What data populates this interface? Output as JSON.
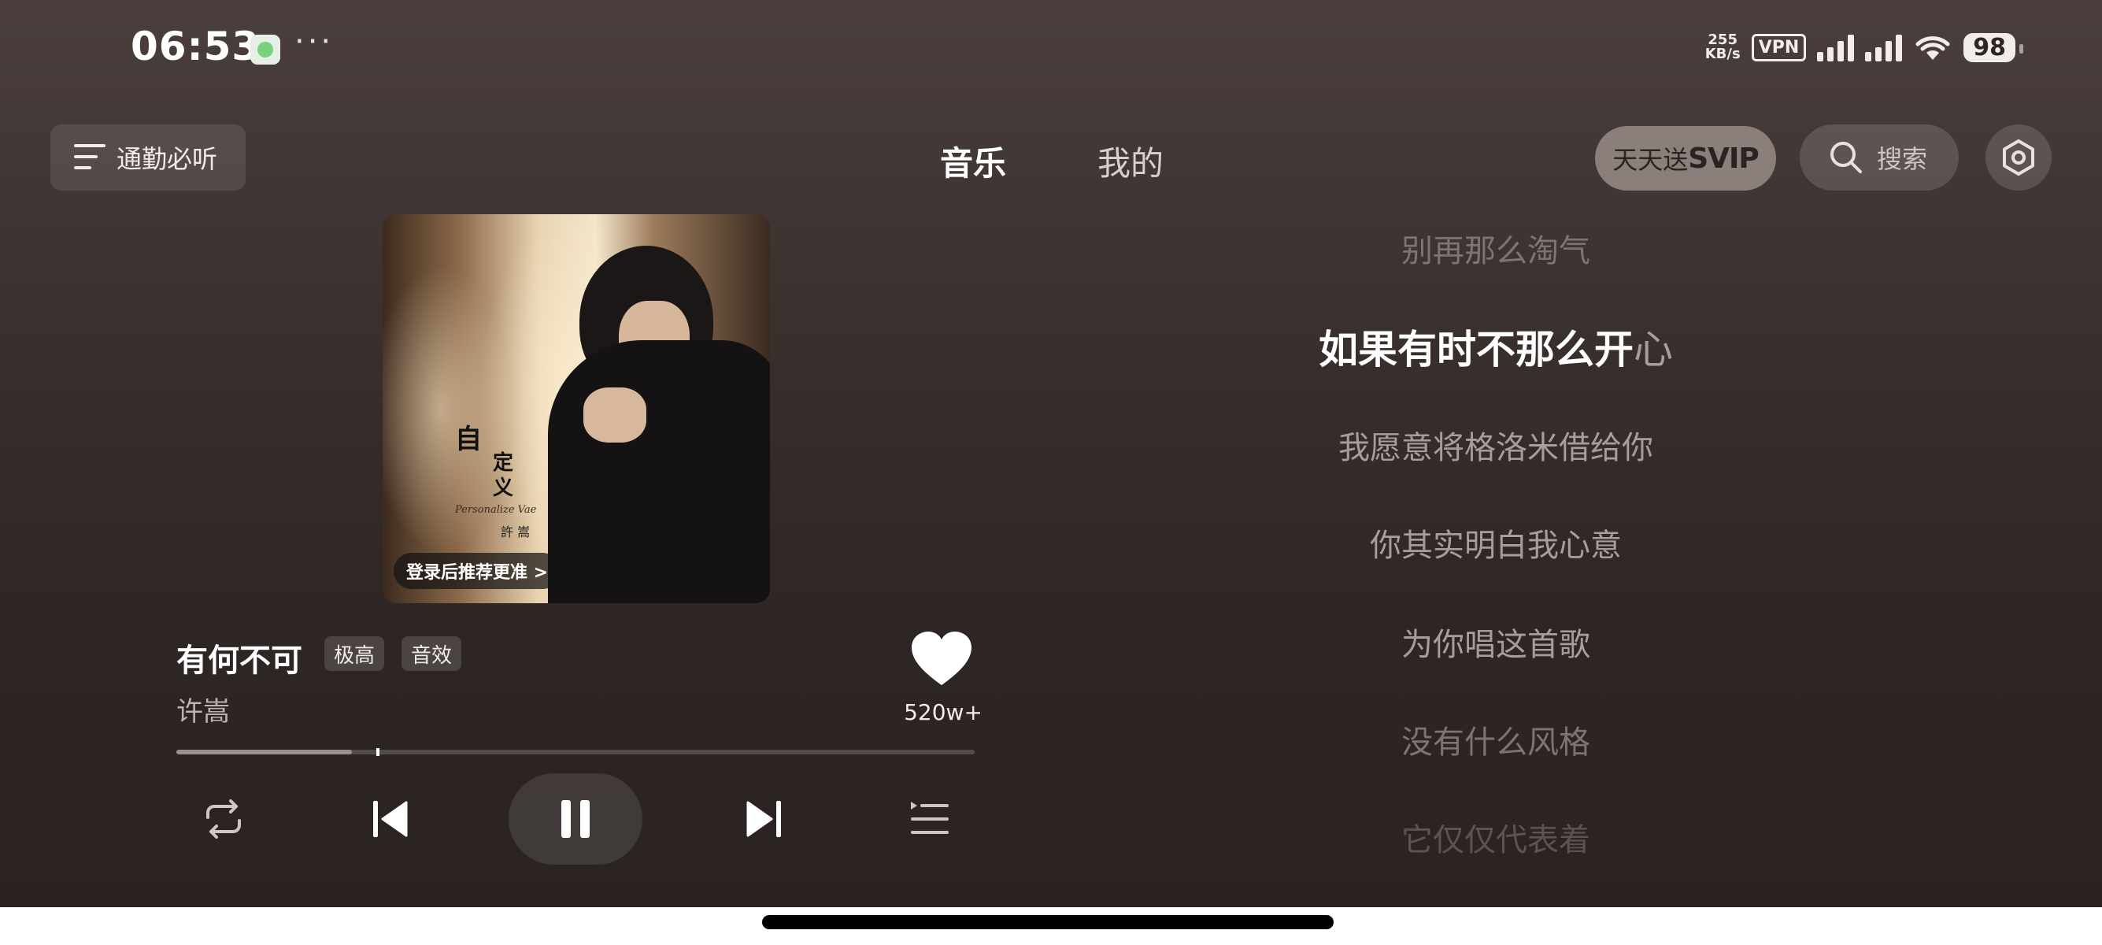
{
  "status_bar": {
    "time": "06:53",
    "more": "···",
    "net_speed_value": "255",
    "net_speed_unit": "KB/s",
    "vpn_label": "VPN",
    "battery": "98"
  },
  "nav": {
    "commute_label": "通勤必听",
    "tabs": [
      {
        "label": "音乐",
        "active": true
      },
      {
        "label": "我的",
        "active": false
      }
    ],
    "svip_prefix": "天天送",
    "svip_suffix": "SVIP",
    "search_label": "搜索"
  },
  "album": {
    "cover_title_1": "自",
    "cover_title_2": "定\n义",
    "cover_subtitle": "Personalize Vae",
    "cover_artist": "許 嵩",
    "login_prompt": "登录后推荐更准 >"
  },
  "song": {
    "title": "有何不可",
    "quality_tag": "极高",
    "effect_tag": "音效",
    "artist": "许嵩",
    "like_count": "520w+",
    "progress": 0.22,
    "buffer_marker": 0.25
  },
  "lyrics": {
    "lines": [
      {
        "text": "别再那么淘气",
        "state": "fade"
      },
      {
        "text": "我愿意将格洛米借给你",
        "state": "normal"
      },
      {
        "text": "你其实明白我心意",
        "state": "normal"
      },
      {
        "text": "为你唱这首歌",
        "state": "normal"
      },
      {
        "text": "没有什么风格",
        "state": "fade"
      },
      {
        "text": "它仅仅代表着",
        "state": "faint"
      }
    ],
    "active_sung": "如果有时不那么",
    "active_partial": "开",
    "active_remaining": "心"
  },
  "colors": {
    "background_top": "#4a3f3d",
    "background_bottom": "#2a2321",
    "svip_pill": "#8a7f7b"
  },
  "icons": [
    "menu-icon",
    "search-icon",
    "settings-icon",
    "heart-icon",
    "repeat-icon",
    "previous-icon",
    "pause-icon",
    "next-icon",
    "playlist-icon",
    "wifi-icon",
    "signal-icon"
  ]
}
